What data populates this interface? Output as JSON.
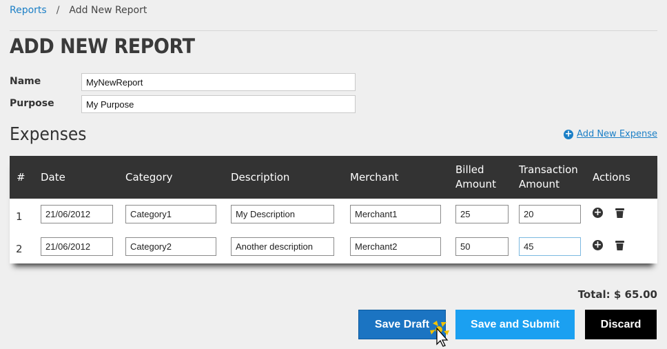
{
  "breadcrumb": {
    "root": "Reports",
    "separator": "/",
    "current": "Add New Report"
  },
  "page_title": "ADD NEW REPORT",
  "form": {
    "name_label": "Name",
    "name_value": "MyNewReport",
    "purpose_label": "Purpose",
    "purpose_value": "My Purpose"
  },
  "expenses": {
    "title": "Expenses",
    "add_link": "Add New Expense",
    "columns": {
      "num": "#",
      "date": "Date",
      "category": "Category",
      "description": "Description",
      "merchant": "Merchant",
      "billed_1": "Billed",
      "billed_2": "Amount",
      "transaction_1": "Transaction",
      "transaction_2": "Amount",
      "actions": "Actions"
    },
    "rows": [
      {
        "num": "1",
        "date": "21/06/2012",
        "category": "Category1",
        "description": "My Description",
        "merchant": "Merchant1",
        "billed": "25",
        "transaction": "20"
      },
      {
        "num": "2",
        "date": "21/06/2012",
        "category": "Category2",
        "description": "Another description",
        "merchant": "Merchant2",
        "billed": "50",
        "transaction": "45"
      }
    ]
  },
  "total": "Total: $ 65.00",
  "buttons": {
    "save_draft": "Save Draft",
    "save_submit": "Save and Submit",
    "discard": "Discard"
  },
  "icons": {
    "add": "plus-circle-icon",
    "delete": "trash-icon",
    "cursor": "mouse-pointer-icon"
  }
}
